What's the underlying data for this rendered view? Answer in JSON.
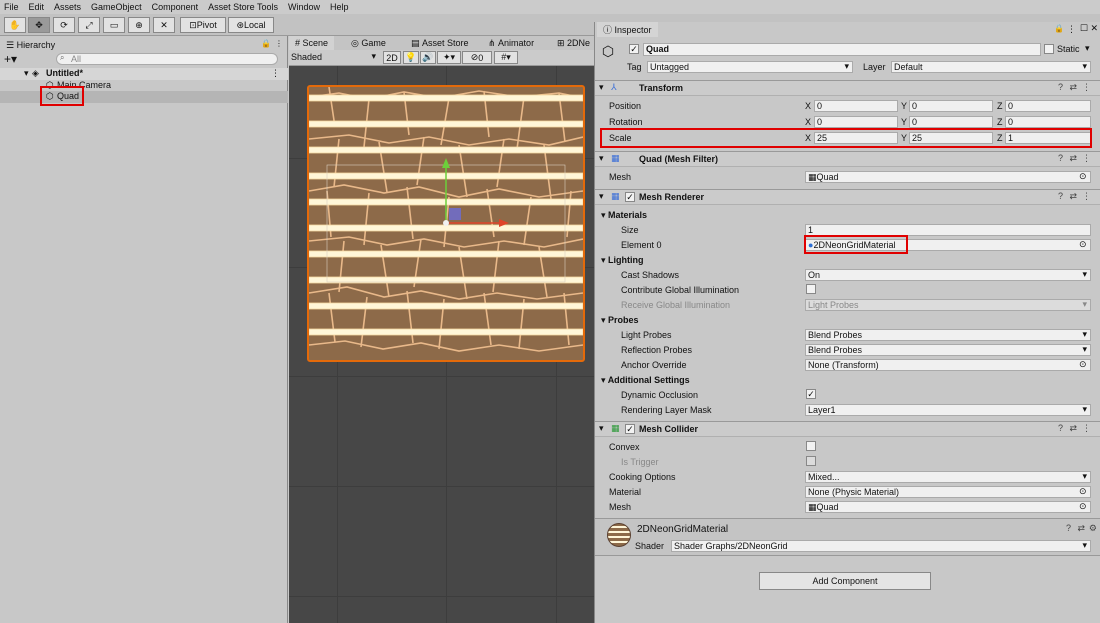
{
  "menu": [
    "File",
    "Edit",
    "Assets",
    "GameObject",
    "Component",
    "Asset Store Tools",
    "Window",
    "Help"
  ],
  "toolbar": {
    "pivot": "Pivot",
    "local": "Local"
  },
  "hierarchy": {
    "tab": "Hierarchy",
    "search_placeholder": "All",
    "scene": "Untitled*",
    "items": [
      "Main Camera",
      "Quad"
    ]
  },
  "scene_tabs": [
    "Scene",
    "Game",
    "Asset Store",
    "Animator",
    "2DNe"
  ],
  "scene_toolbar": {
    "shading": "Shaded",
    "mode2d": "2D",
    "gizmo_count": "0"
  },
  "inspector": {
    "tab": "Inspector",
    "object_name": "Quad",
    "static_label": "Static",
    "tag_label": "Tag",
    "tag": "Untagged",
    "layer_label": "Layer",
    "layer": "Default",
    "transform": {
      "title": "Transform",
      "position": {
        "label": "Position",
        "x": "0",
        "y": "0",
        "z": "0"
      },
      "rotation": {
        "label": "Rotation",
        "x": "0",
        "y": "0",
        "z": "0"
      },
      "scale": {
        "label": "Scale",
        "x": "25",
        "y": "25",
        "z": "1"
      }
    },
    "mesh_filter": {
      "title": "Quad (Mesh Filter)",
      "mesh_label": "Mesh",
      "mesh": "Quad"
    },
    "mesh_renderer": {
      "title": "Mesh Renderer",
      "materials": "Materials",
      "size_label": "Size",
      "size": "1",
      "element0_label": "Element 0",
      "element0": "2DNeonGridMaterial",
      "lighting": "Lighting",
      "cast_shadows_label": "Cast Shadows",
      "cast_shadows": "On",
      "contrib_gi_label": "Contribute Global Illumination",
      "receive_gi_label": "Receive Global Illumination",
      "receive_gi": "Light Probes",
      "probes": "Probes",
      "light_probes_label": "Light Probes",
      "light_probes": "Blend Probes",
      "reflection_probes_label": "Reflection Probes",
      "reflection_probes": "Blend Probes",
      "anchor_label": "Anchor Override",
      "anchor": "None (Transform)",
      "additional": "Additional Settings",
      "dynamic_occlusion_label": "Dynamic Occlusion",
      "render_layer_label": "Rendering Layer Mask",
      "render_layer": "Layer1"
    },
    "mesh_collider": {
      "title": "Mesh Collider",
      "convex_label": "Convex",
      "trigger_label": "Is Trigger",
      "cooking_label": "Cooking Options",
      "cooking": "Mixed...",
      "material_label": "Material",
      "material": "None (Physic Material)",
      "mesh_label": "Mesh",
      "mesh": "Quad"
    },
    "material": {
      "name": "2DNeonGridMaterial",
      "shader_label": "Shader",
      "shader": "Shader Graphs/2DNeonGrid"
    },
    "add_component": "Add Component"
  },
  "colors": {
    "highlight": "#e00000",
    "quad_border": "#e46a0a",
    "stripe": "#fff6d8",
    "stone": "#8d6a49"
  }
}
